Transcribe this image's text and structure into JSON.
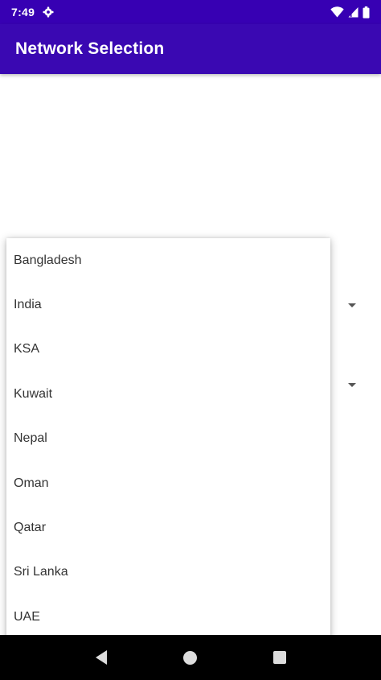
{
  "status_bar": {
    "time": "7:49",
    "icons": [
      "gear-icon",
      "wifi-icon",
      "signal-icon",
      "battery-icon"
    ]
  },
  "app_bar": {
    "title": "Network Selection"
  },
  "dropdown": {
    "items": [
      {
        "label": "Bangladesh"
      },
      {
        "label": "India"
      },
      {
        "label": "KSA"
      },
      {
        "label": "Kuwait"
      },
      {
        "label": "Nepal"
      },
      {
        "label": "Oman"
      },
      {
        "label": "Qatar"
      },
      {
        "label": "Sri Lanka"
      },
      {
        "label": "UAE"
      }
    ]
  },
  "nav_bar": {
    "buttons": [
      "back-icon",
      "home-icon",
      "recents-icon"
    ]
  },
  "colors": {
    "status_bar": "#3700b3",
    "app_bar": "#3a08b2",
    "nav_bar": "#000000"
  }
}
